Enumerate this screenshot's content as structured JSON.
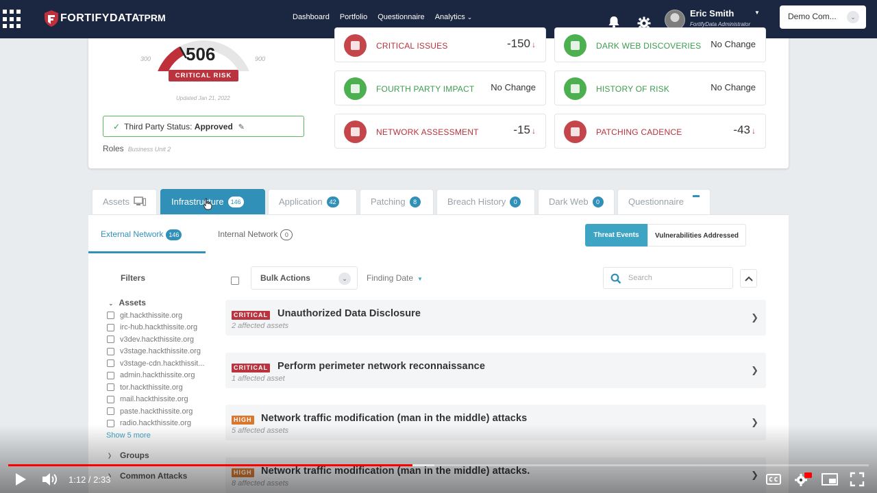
{
  "nav": {
    "brand": "FORTIFYDATA",
    "product": "TPRM",
    "links": [
      {
        "label": "Dashboard"
      },
      {
        "label": "Portfolio"
      },
      {
        "label": "Questionnaire"
      },
      {
        "label": "Analytics"
      }
    ],
    "user": {
      "name": "Eric Smith",
      "role": "FortifyData Administrator"
    },
    "company": "Demo Com..."
  },
  "summary": {
    "score": "506",
    "score_fraction": 0.34,
    "gauge_min": "300",
    "gauge_max": "900",
    "risk_label": "CRITICAL RISK",
    "updated": "Updated Jan 21, 2022",
    "status_label": "Third Party Status:",
    "status_value": "Approved",
    "roles_label": "Roles",
    "roles_value": "Business Unit 2",
    "metrics": [
      {
        "label": "CRITICAL ISSUES",
        "value": "-150",
        "arrow": "↓",
        "tone": "red"
      },
      {
        "label": "DARK WEB DISCOVERIES",
        "value": "No Change",
        "arrow": "",
        "tone": "green"
      },
      {
        "label": "FOURTH PARTY IMPACT",
        "value": "No Change",
        "arrow": "",
        "tone": "green"
      },
      {
        "label": "HISTORY OF RISK",
        "value": "No Change",
        "arrow": "",
        "tone": "green"
      },
      {
        "label": "NETWORK ASSESSMENT",
        "value": "-15",
        "arrow": "↓",
        "tone": "red"
      },
      {
        "label": "PATCHING CADENCE",
        "value": "-43",
        "arrow": "↓",
        "tone": "red"
      }
    ]
  },
  "tabs": [
    {
      "label": "Assets",
      "count": ""
    },
    {
      "label": "Infrastructure",
      "count": "146"
    },
    {
      "label": "Application",
      "count": "42"
    },
    {
      "label": "Patching",
      "count": "8"
    },
    {
      "label": "Breach History",
      "count": "0"
    },
    {
      "label": "Dark Web",
      "count": "0"
    },
    {
      "label": "Questionnaire",
      "count": ""
    }
  ],
  "subtabs": {
    "external": {
      "label": "External Network",
      "count": "146"
    },
    "internal": {
      "label": "Internal Network",
      "count": "0"
    }
  },
  "toggle": {
    "on": "Threat Events",
    "off": "Vulnerabilities Addressed"
  },
  "filters": {
    "title": "Filters",
    "assets_label": "Assets",
    "assets": [
      "git.hackthissite.org",
      "irc-hub.hackthissite.org",
      "v3dev.hackthissite.org",
      "v3stage.hackthissite.org",
      "v3stage-cdn.hackthissit...",
      "admin.hackthissite.org",
      "tor.hackthissite.org",
      "mail.hackthissite.org",
      "paste.hackthissite.org",
      "radio.hackthissite.org"
    ],
    "show_more": "Show 5 more",
    "groups_label": "Groups",
    "attacks_label": "Common Attacks"
  },
  "toolbar": {
    "bulk_actions": "Bulk Actions",
    "finding_date": "Finding Date",
    "search_placeholder": "Search"
  },
  "findings": [
    {
      "severity": "CRITICAL",
      "title": "Unauthorized Data Disclosure",
      "sub": "2 affected assets"
    },
    {
      "severity": "CRITICAL",
      "title": "Perform perimeter network reconnaissance",
      "sub": "1 affected asset"
    },
    {
      "severity": "HIGH",
      "title": "Network traffic modification (man in the middle) attacks",
      "sub": "5 affected assets"
    },
    {
      "severity": "HIGH",
      "title": "Network traffic modification (man in the middle) attacks.",
      "sub": "8 affected assets"
    }
  ],
  "player": {
    "time": "1:12 / 2:33",
    "played_fraction": 0.47,
    "buffered_fraction": 0.495
  }
}
